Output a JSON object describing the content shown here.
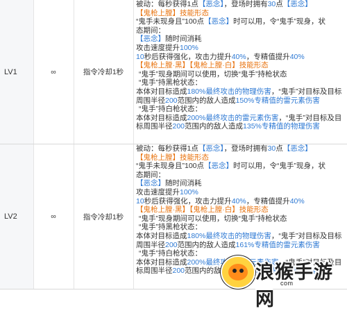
{
  "rows": [
    {
      "level": "LV1",
      "count": "∞",
      "cooldown": "指令冷却1秒",
      "lines": [
        [
          {
            "t": "被动：每秒获得1点"
          },
          {
            "t": "【恶念】",
            "c": "blue"
          },
          {
            "t": "，登场时拥有"
          },
          {
            "t": "30",
            "c": "blue"
          },
          {
            "t": "点"
          },
          {
            "t": "【恶念】",
            "c": "blue"
          }
        ],
        [
          {
            "t": "【鬼枪上膛】技能形态",
            "c": "orange"
          }
        ],
        [
          {
            "t": "“鬼手未现身且”100点"
          },
          {
            "t": "【恶念】",
            "c": "blue"
          },
          {
            "t": "时可以用，令“鬼手”现身，状"
          }
        ],
        [
          {
            "t": "态期间："
          }
        ],
        [
          {
            "t": "【恶念】",
            "c": "blue"
          },
          {
            "t": "随时间消耗"
          }
        ],
        [
          {
            "t": "攻击速度提升"
          },
          {
            "t": "100%",
            "c": "blue"
          }
        ],
        [
          {
            "t": "10",
            "c": "blue"
          },
          {
            "t": "秒后获得强化，攻击力提升"
          },
          {
            "t": "40%",
            "c": "blue"
          },
          {
            "t": "，专精值提升"
          },
          {
            "t": "40%",
            "c": "blue"
          }
        ],
        [
          {
            "t": "【鬼枪上膛·黑】【鬼枪上膛·白】技能形态",
            "c": "orange"
          }
        ],
        [
          {
            "t": "“鬼手”现身期间可以使用，切换“鬼手”持枪状态",
            "i": 1
          }
        ],
        [
          {
            "t": "“鬼手”持黑枪状态：",
            "i": 1
          }
        ],
        [
          {
            "t": "本体对目标造成"
          },
          {
            "t": "180%最终攻击的物理伤害",
            "c": "blue"
          },
          {
            "t": "，“鬼手”对目标及目标"
          }
        ],
        [
          {
            "t": "周围半径"
          },
          {
            "t": "200",
            "c": "blue"
          },
          {
            "t": "范围内的敌人造成"
          },
          {
            "t": "150%专精值的雷元素伤害",
            "c": "blue"
          }
        ],
        [
          {
            "t": "“鬼手”持白枪状态：",
            "i": 1
          }
        ],
        [
          {
            "t": "本体对目标造成"
          },
          {
            "t": "200%最终攻击的雷元素伤害",
            "c": "blue"
          },
          {
            "t": "，“鬼手”对目标及目"
          }
        ],
        [
          {
            "t": "标周围半径"
          },
          {
            "t": "200",
            "c": "blue"
          },
          {
            "t": "范围内的敌人造成"
          },
          {
            "t": "135%专精值的物理伤害",
            "c": "blue"
          }
        ]
      ]
    },
    {
      "level": "LV2",
      "count": "∞",
      "cooldown": "指令冷却1秒",
      "lines": [
        [
          {
            "t": "被动：每秒获得1点"
          },
          {
            "t": "【恶念】",
            "c": "blue"
          },
          {
            "t": "，登场时拥有"
          },
          {
            "t": "30",
            "c": "blue"
          },
          {
            "t": "点"
          },
          {
            "t": "【恶念】",
            "c": "blue"
          }
        ],
        [
          {
            "t": "【鬼枪上膛】技能形态",
            "c": "orange"
          }
        ],
        [
          {
            "t": "“鬼手未现身且”100点"
          },
          {
            "t": "【恶念】",
            "c": "blue"
          },
          {
            "t": "时可以用，令“鬼手”现身，状"
          }
        ],
        [
          {
            "t": "态期间："
          }
        ],
        [
          {
            "t": "【恶念】",
            "c": "blue"
          },
          {
            "t": "随时间消耗"
          }
        ],
        [
          {
            "t": "攻击速度提升"
          },
          {
            "t": "100%",
            "c": "blue"
          }
        ],
        [
          {
            "t": "10",
            "c": "blue"
          },
          {
            "t": "秒后获得强化，攻击力提升"
          },
          {
            "t": "40%",
            "c": "blue"
          },
          {
            "t": "，专精值提升"
          },
          {
            "t": "40%",
            "c": "blue"
          }
        ],
        [
          {
            "t": "【鬼枪上膛·黑】【鬼枪上膛·白】技能形态",
            "c": "orange"
          }
        ],
        [
          {
            "t": "“鬼手”现身期间可以使用，切换“鬼手”持枪状态",
            "i": 1
          }
        ],
        [
          {
            "t": "“鬼手”持黑枪状态：",
            "i": 1
          }
        ],
        [
          {
            "t": "本体对目标造成"
          },
          {
            "t": "180%最终攻击的物理伤害",
            "c": "blue"
          },
          {
            "t": "，“鬼手”对目标及目标"
          }
        ],
        [
          {
            "t": "周围半径"
          },
          {
            "t": "200",
            "c": "blue"
          },
          {
            "t": "范围内的敌人造成"
          },
          {
            "t": "161%专精值的雷元素伤害",
            "c": "blue"
          }
        ],
        [
          {
            "t": "“鬼手”持白枪状态：",
            "i": 1
          }
        ],
        [
          {
            "t": "本体对目标造成"
          },
          {
            "t": "200%最终攻击的雷元素伤害",
            "c": "blue"
          },
          {
            "t": "，“鬼手”对目标及目"
          }
        ],
        [
          {
            "t": "标周围半径"
          },
          {
            "t": "200",
            "c": "blue"
          },
          {
            "t": "范围内的敌人造成"
          },
          {
            "t": "145%专精值的物理伤害",
            "c": "blue"
          }
        ]
      ]
    }
  ],
  "watermark": {
    "text": "浪猴手游网",
    "url": "com"
  },
  "colors": {
    "highlight_blue": "#2f7ad4",
    "highlight_orange": "#e8730f",
    "level_bg": "#f6f7f9",
    "border": "#d9d9d9"
  }
}
